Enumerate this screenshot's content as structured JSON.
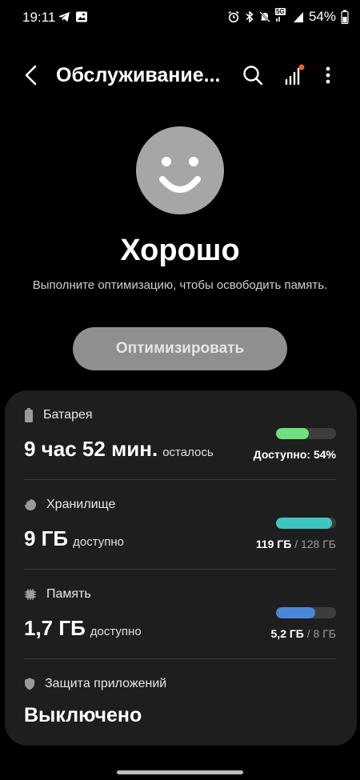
{
  "status_bar": {
    "time": "19:11",
    "battery": "54%",
    "network": "5G"
  },
  "appbar": {
    "title": "Обслуживание..."
  },
  "status": {
    "title": "Хорошо",
    "description": "Выполните оптимизацию, чтобы освободить память.",
    "button": "Оптимизировать"
  },
  "battery": {
    "label": "Батарея",
    "value": "9 час 52 мин.",
    "suffix": "осталось",
    "meta": "Доступно: 54%",
    "level": 0.54,
    "color": "#6ee07f"
  },
  "storage": {
    "label": "Хранилище",
    "value": "9 ГБ",
    "suffix": "доступно",
    "used": "119 ГБ",
    "total": " / 128 ГБ",
    "level": 0.93,
    "color": "#3fc6c0"
  },
  "memory": {
    "label": "Память",
    "value": "1,7 ГБ",
    "suffix": "доступно",
    "used": "5,2 ГБ",
    "total": " / 8 ГБ",
    "level": 0.65,
    "color": "#4a87d9"
  },
  "protection": {
    "label": "Защита приложений",
    "value": "Выключено"
  },
  "colors": {
    "accent_dot": "#f0622a",
    "face": "#a6a6a6"
  }
}
